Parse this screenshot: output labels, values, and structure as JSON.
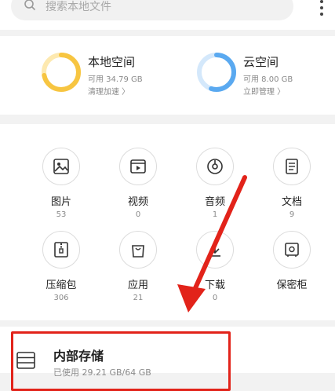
{
  "search": {
    "placeholder": "搜索本地文件"
  },
  "storage": {
    "local": {
      "title": "本地空间",
      "used": "可用 34.79 GB",
      "action": "清理加速 〉",
      "fraction": 0.72,
      "color": "#f7c541"
    },
    "cloud": {
      "title": "云空间",
      "used": "可用 8.00 GB",
      "action": "立即管理 〉",
      "fraction": 0.55,
      "color": "#5aa9f0"
    }
  },
  "categories": [
    {
      "label": "图片",
      "count": "53",
      "icon": "image-icon"
    },
    {
      "label": "视频",
      "count": "0",
      "icon": "video-icon"
    },
    {
      "label": "音频",
      "count": "1",
      "icon": "music-disc-icon"
    },
    {
      "label": "文档",
      "count": "9",
      "icon": "document-icon"
    },
    {
      "label": "压缩包",
      "count": "306",
      "icon": "zip-icon"
    },
    {
      "label": "应用",
      "count": "21",
      "icon": "app-bag-icon"
    },
    {
      "label": "下载",
      "count": "0",
      "icon": "download-icon"
    },
    {
      "label": "保密柜",
      "count": "",
      "icon": "safe-icon"
    }
  ],
  "internal_storage": {
    "title": "内部存储",
    "subtitle": "已使用 29.21 GB/64 GB"
  },
  "colors": {
    "highlight": "#e2231a",
    "arrow": "#e2231a"
  }
}
